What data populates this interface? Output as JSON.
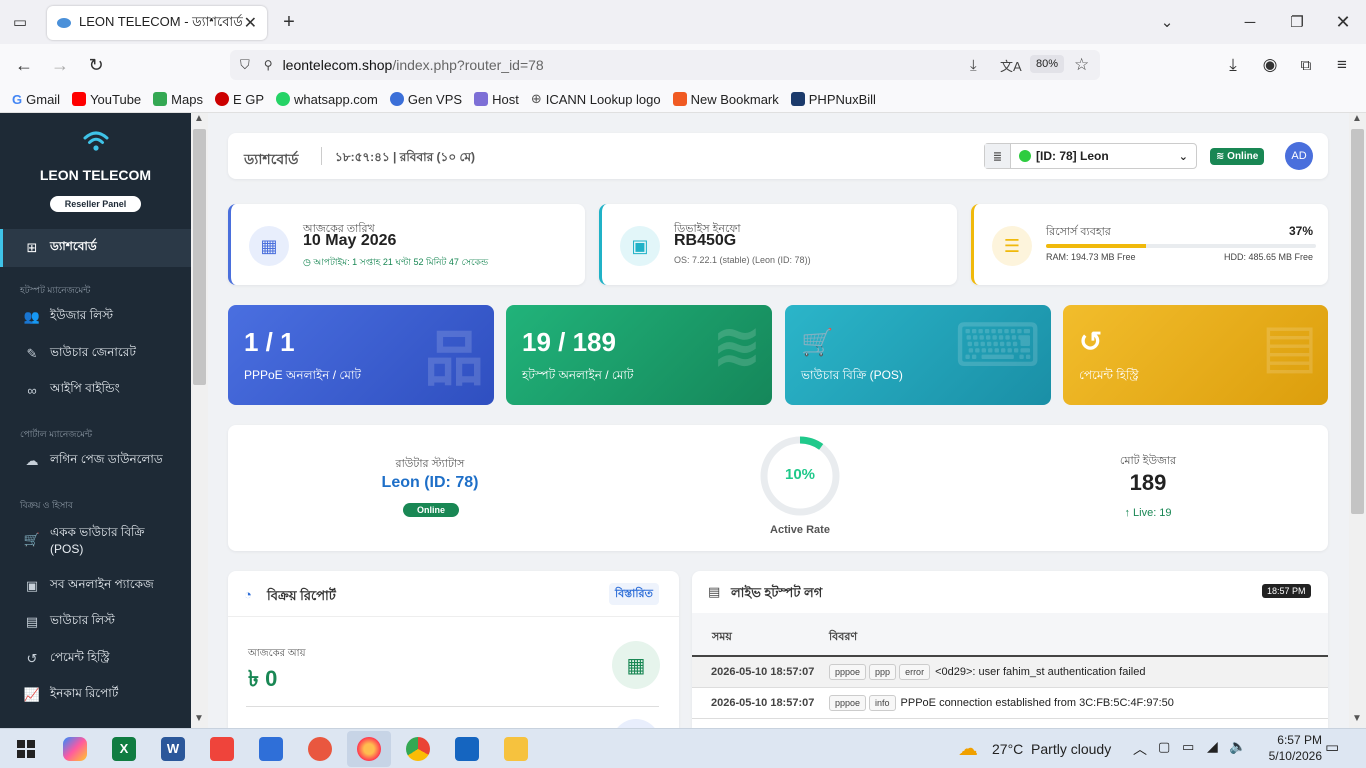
{
  "browser": {
    "tab_title": "LEON TELECOM - ড্যাশবোর্ড",
    "url_domain": "leontelecom.shop",
    "url_path": "/index.php?router_id=78",
    "zoom": "80%",
    "bookmarks": [
      "Gmail",
      "YouTube",
      "Maps",
      "E GP",
      "whatsapp.com",
      "Gen VPS",
      "Host",
      "ICANN Lookup logo",
      "New Bookmark",
      "PHPNuxBill"
    ]
  },
  "sidebar": {
    "brand": "LEON TELECOM",
    "panel": "Reseller Panel",
    "dashboard": "ড্যাশবোর্ড",
    "sec_hotspot": "হটস্পট ম্যানেজমেন্ট",
    "users": "ইউজার লিস্ট",
    "voucher_gen": "ভাউচার জেনারেট",
    "ip_binding": "আইপি বাইন্ডিং",
    "sec_portal": "পোর্টাল ম্যানেজমেন্ট",
    "login_dl": "লগিন পেজ ডাউনলোড",
    "sec_sales": "বিক্রয় ও হিসাব",
    "pos_line1": "একক ভাউচার বিক্রি",
    "pos_line2": "(POS)",
    "all_pkgs": "সব অনলাইন প্যাকেজ",
    "voucher_list": "ভাউচার লিস্ট",
    "payment_hist": "পেমেন্ট হিস্ট্রি",
    "income": "ইনকাম রিপোর্ট"
  },
  "header": {
    "title": "ড্যাশবোর্ড",
    "clock": "১৮:৫৭:৪১ | রবিবার (১০ মে)",
    "router_select": "[ID: 78] Leon",
    "status": "Online",
    "avatar": "AD"
  },
  "info": {
    "date_label": "আজকের তারিখ",
    "date": "10 May 2026",
    "uptime": "আপটাইম: 1 সপ্তাহ 21 ঘণ্টা 52 মিনিট 47 সেকেন্ড",
    "device_label": "ডিভাইস ইনফো",
    "device": "RB450G",
    "os": "OS: 7.22.1 (stable) (Leon (ID: 78))",
    "res_label": "রিসোর্স ব্যবহার",
    "res_pct": "37%",
    "res_fraction": 0.37,
    "ram": "RAM: 194.73 MB Free",
    "hdd": "HDD: 485.65 MB Free"
  },
  "stats": [
    {
      "num": "1 / 1",
      "label": "PPPoE অনলাইন / মোট"
    },
    {
      "num": "19 / 189",
      "label": "হটস্পট অনলাইন / মোট"
    },
    {
      "num": "",
      "label": "ভাউচার বিক্রি (POS)"
    },
    {
      "num": "",
      "label": "পেমেন্ট হিস্ট্রি"
    }
  ],
  "router": {
    "status_label": "রাউটার স্ট্যাটাস",
    "name": "Leon (ID: 78)",
    "status": "Online",
    "active_pct": "10%",
    "active_fraction": 0.1,
    "active_label": "Active Rate",
    "total_label": "মোট ইউজার",
    "total": "189",
    "live": "Live: 19"
  },
  "sales": {
    "title": "বিক্রয় রিপোর্ট",
    "details": "বিস্তারিত",
    "today_label": "আজকের আয়",
    "today_value": "৳ 0"
  },
  "log": {
    "title": "লাইভ হটস্পট লগ",
    "time": "18:57 PM",
    "col_time": "সময়",
    "col_desc": "বিবরণ",
    "rows": [
      {
        "time": "2026-05-10 18:57:07",
        "tags": [
          "pppoe",
          "ppp",
          "error"
        ],
        "msg": "<0d29>: user fahim_st authentication failed"
      },
      {
        "time": "2026-05-10 18:57:07",
        "tags": [
          "pppoe",
          "info"
        ],
        "msg": "PPPoE connection established from 3C:FB:5C:4F:97:50"
      }
    ]
  },
  "taskbar": {
    "weather": "27°C  Partly cloudy",
    "time": "6:57 PM",
    "date": "5/10/2026"
  }
}
